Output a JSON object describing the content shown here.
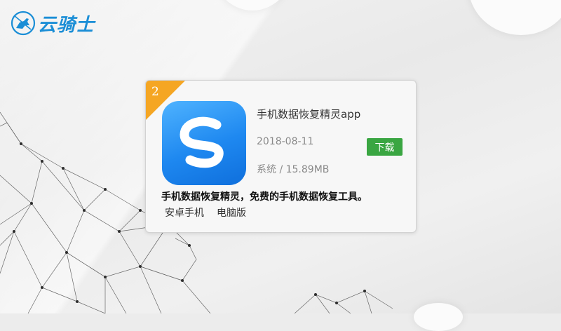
{
  "logo": {
    "text": "云骑士",
    "icon": "knight-rider-icon",
    "color": "#1b8ed6"
  },
  "card": {
    "rank": "2",
    "rank_color": "#f5a623",
    "app_icon": "s-logo-icon",
    "app_icon_color": "#1e88f0",
    "app_name": "手机数据恢复精灵app",
    "date": "2018-08-11",
    "download_label": "下载",
    "download_color": "#3aa642",
    "meta": "系统 / 15.89MB",
    "description": "手机数据恢复精灵，免费的手机数据恢复工具。",
    "platforms": [
      "安卓手机",
      "电脑版"
    ]
  }
}
